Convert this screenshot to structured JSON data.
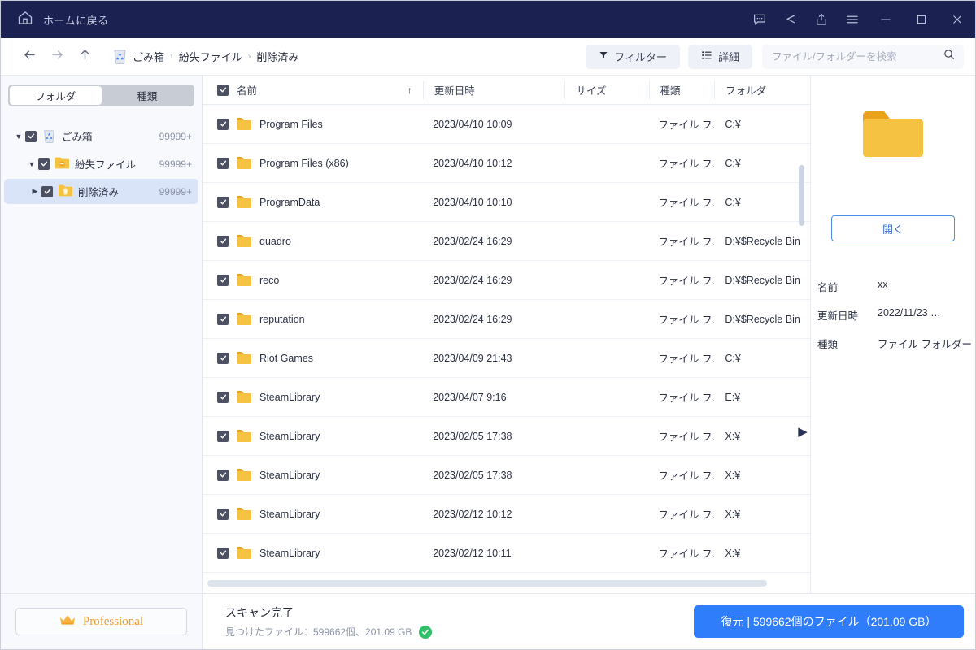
{
  "titlebar": {
    "home_label": "ホームに戻る",
    "home_icon": "home-icon",
    "icons": [
      {
        "name": "feedback-icon",
        "title": "フィードバック"
      },
      {
        "name": "share-icon",
        "title": "共有"
      },
      {
        "name": "export-icon",
        "title": "エクスポート"
      },
      {
        "name": "menu-icon",
        "title": "メニュー"
      },
      {
        "name": "minimize-icon",
        "title": "最小化"
      },
      {
        "name": "maximize-icon",
        "title": "最大化"
      },
      {
        "name": "close-icon",
        "title": "閉じる"
      }
    ]
  },
  "toolbar": {
    "back_icon": "arrow-left-icon",
    "forward_icon": "arrow-right-icon",
    "up_icon": "arrow-up-icon",
    "breadcrumb_icon": "recycle-bin-icon",
    "breadcrumbs": [
      "ごみ箱",
      "紛失ファイル",
      "削除済み"
    ],
    "separator": "›",
    "filter_label": "フィルター",
    "filter_icon": "funnel-icon",
    "details_label": "詳細",
    "details_icon": "list-icon",
    "search_placeholder": "ファイル/フォルダーを検索",
    "search_value": "",
    "search_icon": "search-icon"
  },
  "sidebar": {
    "tabs": [
      {
        "label": "フォルダ",
        "active": true
      },
      {
        "label": "種類",
        "active": false
      }
    ],
    "tree": [
      {
        "label": "ごみ箱",
        "count": "99999+",
        "icon": "recycle-bin-icon",
        "expanded": true,
        "selected": false,
        "depth": 0,
        "twisty": "▼"
      },
      {
        "label": "紛失ファイル",
        "count": "99999+",
        "icon": "lost-folder-icon",
        "expanded": true,
        "selected": false,
        "depth": 1,
        "twisty": "▼"
      },
      {
        "label": "削除済み",
        "count": "99999+",
        "icon": "deleted-folder-icon",
        "expanded": false,
        "selected": true,
        "depth": 2,
        "twisty": "▶"
      }
    ],
    "pro_label": "Professional",
    "pro_icon": "crown-icon"
  },
  "filelist": {
    "columns": [
      {
        "key": "name",
        "label": "名前",
        "sorted": true,
        "sort_icon": "↑"
      },
      {
        "key": "date",
        "label": "更新日時"
      },
      {
        "key": "size",
        "label": "サイズ"
      },
      {
        "key": "kind",
        "label": "種類"
      },
      {
        "key": "folder",
        "label": "フォルダ"
      }
    ],
    "header_checkbox_checked": true,
    "rows": [
      {
        "checked": true,
        "icon": "folder-icon",
        "name": "Program Files",
        "date": "2023/04/10 10:09",
        "size": "",
        "kind": "ファイル フ…",
        "folder": "C:¥"
      },
      {
        "checked": true,
        "icon": "folder-icon",
        "name": "Program Files (x86)",
        "date": "2023/04/10 10:12",
        "size": "",
        "kind": "ファイル フ…",
        "folder": "C:¥"
      },
      {
        "checked": true,
        "icon": "folder-icon",
        "name": "ProgramData",
        "date": "2023/04/10 10:10",
        "size": "",
        "kind": "ファイル フ…",
        "folder": "C:¥"
      },
      {
        "checked": true,
        "icon": "folder-icon",
        "name": "quadro",
        "date": "2023/02/24 16:29",
        "size": "",
        "kind": "ファイル フ…",
        "folder": "D:¥$Recycle Bin"
      },
      {
        "checked": true,
        "icon": "folder-icon",
        "name": "reco",
        "date": "2023/02/24 16:29",
        "size": "",
        "kind": "ファイル フ…",
        "folder": "D:¥$Recycle Bin"
      },
      {
        "checked": true,
        "icon": "folder-icon",
        "name": "reputation",
        "date": "2023/02/24 16:29",
        "size": "",
        "kind": "ファイル フ…",
        "folder": "D:¥$Recycle Bin"
      },
      {
        "checked": true,
        "icon": "folder-icon",
        "name": "Riot Games",
        "date": "2023/04/09 21:43",
        "size": "",
        "kind": "ファイル フ…",
        "folder": "C:¥"
      },
      {
        "checked": true,
        "icon": "folder-icon",
        "name": "SteamLibrary",
        "date": "2023/04/07 9:16",
        "size": "",
        "kind": "ファイル フ…",
        "folder": "E:¥"
      },
      {
        "checked": true,
        "icon": "folder-icon",
        "name": "SteamLibrary",
        "date": "2023/02/05 17:38",
        "size": "",
        "kind": "ファイル フ…",
        "folder": "X:¥"
      },
      {
        "checked": true,
        "icon": "folder-icon",
        "name": "SteamLibrary",
        "date": "2023/02/05 17:38",
        "size": "",
        "kind": "ファイル フ…",
        "folder": "X:¥"
      },
      {
        "checked": true,
        "icon": "folder-icon",
        "name": "SteamLibrary",
        "date": "2023/02/12 10:12",
        "size": "",
        "kind": "ファイル フ…",
        "folder": "X:¥"
      },
      {
        "checked": true,
        "icon": "folder-icon",
        "name": "SteamLibrary",
        "date": "2023/02/12 10:11",
        "size": "",
        "kind": "ファイル フ…",
        "folder": "X:¥"
      }
    ],
    "collapse_handle_icon": "triangle-right-icon"
  },
  "preview": {
    "icon": "folder-icon-large",
    "open_label": "開く",
    "meta": [
      {
        "key": "名前",
        "value": "xx"
      },
      {
        "key": "更新日時",
        "value": "2022/11/23 …"
      },
      {
        "key": "種類",
        "value": "ファイル フォルダー"
      }
    ]
  },
  "footer": {
    "status_title": "スキャン完了",
    "status_sub": "見つけたファイル：599662個、201.09 GB",
    "status_icon": "check-circle-icon",
    "recover_label": "復元 | 599662個のファイル（201.09 GB）"
  },
  "colors": {
    "titlebar": "#1b2150",
    "accent_blue": "#2f7dfb",
    "folder_yellow": "#f6c241",
    "pro_orange": "#f09a2e",
    "success_green": "#30c06a",
    "selection_blue": "#dae4f9"
  }
}
